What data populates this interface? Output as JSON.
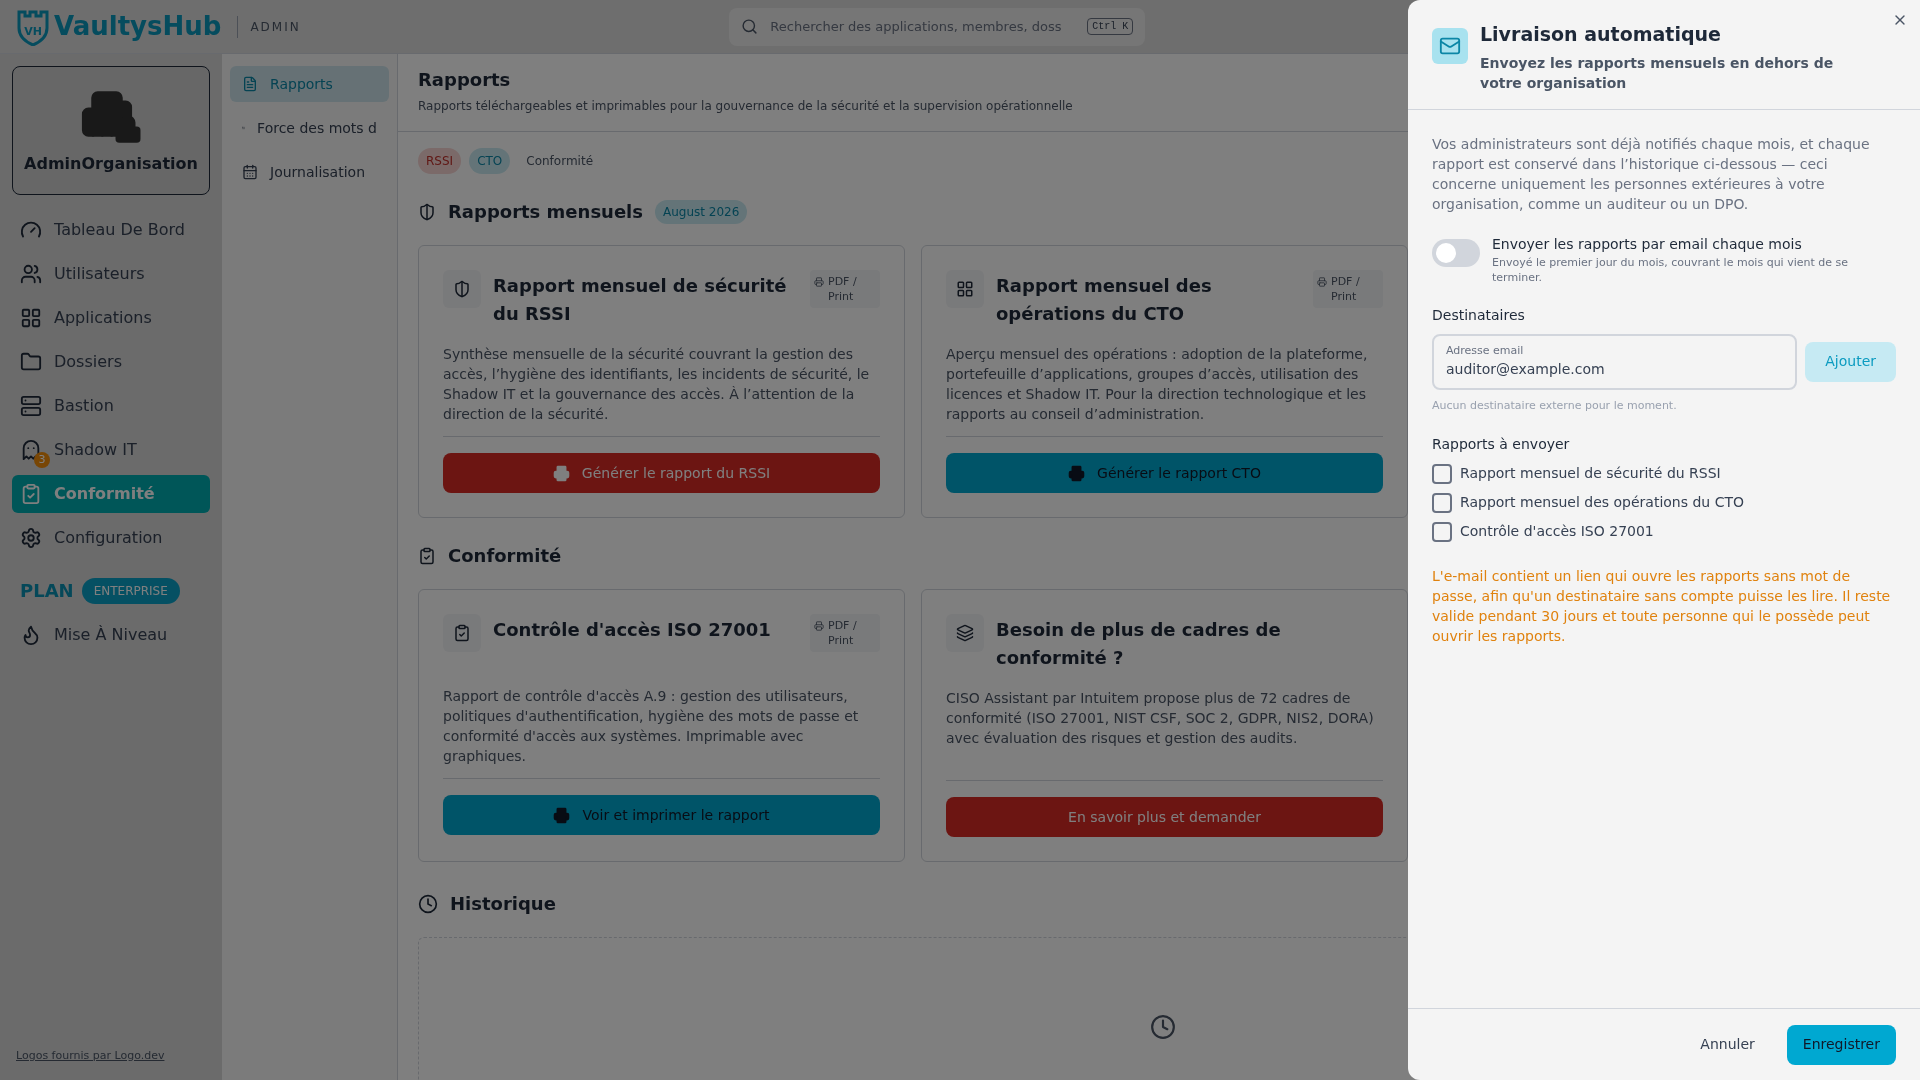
{
  "header": {
    "logo_mark": "VH",
    "brand": "VaultysHub",
    "section": "ADMIN",
    "search": {
      "placeholder": "Rechercher des applications, membres, doss",
      "shortcut": "Ctrl K"
    }
  },
  "organization": {
    "name": "AdminOrganisation"
  },
  "sidebar": {
    "items": [
      {
        "label": "Tableau De Bord",
        "selected": false
      },
      {
        "label": "Utilisateurs",
        "selected": false
      },
      {
        "label": "Applications",
        "selected": false
      },
      {
        "label": "Dossiers",
        "selected": false
      },
      {
        "label": "Bastion",
        "selected": false
      },
      {
        "label": "Shadow IT",
        "selected": false,
        "badge": "3"
      },
      {
        "label": "Conformité",
        "selected": true
      },
      {
        "label": "Configuration",
        "selected": false
      }
    ],
    "plan": {
      "label": "PLAN",
      "tier": "ENTERPRISE"
    },
    "upgrade": {
      "label": "Mise À Niveau"
    },
    "footer_link": "Logos fournis par Logo.dev"
  },
  "subnav": {
    "items": [
      {
        "label": "Rapports",
        "selected": true
      },
      {
        "label": "Force des mots d",
        "selected": false
      },
      {
        "label": "Journalisation",
        "selected": false
      }
    ]
  },
  "page": {
    "title": "Rapports",
    "subtitle": "Rapports téléchargeables et imprimables pour la gouvernance de la sécurité et la supervision opérationnelle",
    "chips": [
      {
        "label": "RSSI",
        "kind": "danger"
      },
      {
        "label": "CTO",
        "kind": "info"
      },
      {
        "label": "Conformité",
        "kind": "plain"
      }
    ],
    "sections": [
      {
        "title": "Rapports mensuels",
        "badge": "August 2026",
        "cards": [
          {
            "title": "Rapport mensuel de sécurité du RSSI",
            "badge": "PDF / Print",
            "description": "Synthèse mensuelle de la sécurité couvrant la gestion des accès, l’hygiène des identifiants, les incidents de sécurité, le Shadow IT et la gouvernance des accès. À l’attention de la direction de la sécurité.",
            "button": {
              "label": "Générer le rapport du RSSI",
              "kind": "danger",
              "printer": true
            }
          },
          {
            "title": "Rapport mensuel des opérations du CTO",
            "badge": "PDF / Print",
            "description": "Aperçu mensuel des opérations : adoption de la plateforme, portefeuille d’applications, groupes d’accès, utilisation des licences et Shadow IT. Pour la direction technologique et les rapports au conseil d’administration.",
            "button": {
              "label": "Générer le rapport CTO",
              "kind": "primary",
              "printer": true
            }
          }
        ]
      },
      {
        "title": "Conformité",
        "cards": [
          {
            "title": "Contrôle d'accès ISO 27001",
            "badge": "PDF / Print",
            "description": "Rapport de contrôle d'accès A.9 : gestion des utilisateurs, politiques d'authentification, hygiène des mots de passe et conformité d'accès aux systèmes. Imprimable avec graphiques.",
            "button": {
              "label": "Voir et imprimer le rapport",
              "kind": "primary",
              "printer": true
            }
          },
          {
            "title": "Besoin de plus de cadres de conformité ?",
            "description": "CISO Assistant par Intuitem propose plus de 72 cadres de conformité (ISO 27001, NIST CSF, SOC 2, GDPR, NIS2, DORA) avec évaluation des risques et gestion des audits.",
            "button": {
              "label": "En savoir plus et demander",
              "kind": "danger",
              "printer": false
            }
          }
        ]
      }
    ],
    "history": {
      "title": "Historique"
    }
  },
  "drawer": {
    "title": "Livraison automatique",
    "subtitle": "Envoyez les rapports mensuels en dehors de votre organisation",
    "intro": "Vos administrateurs sont déjà notifiés chaque mois, et chaque rapport est conservé dans l’historique ci-dessous — ceci concerne uniquement les personnes extérieures à votre organisation, comme un auditeur ou un DPO.",
    "toggle": {
      "label": "Envoyer les rapports par email chaque mois",
      "hint": "Envoyé le premier jour du mois, couvrant le mois qui vient de se terminer.",
      "on": false
    },
    "recipients": {
      "title": "Destinataires",
      "field_label": "Adresse email",
      "placeholder": "auditor@example.com",
      "add_button": "Ajouter",
      "empty_note": "Aucun destinataire externe pour le moment."
    },
    "reports": {
      "title": "Rapports à envoyer",
      "items": [
        {
          "label": "Rapport mensuel de sécurité du RSSI",
          "checked": false
        },
        {
          "label": "Rapport mensuel des opérations du CTO",
          "checked": false
        },
        {
          "label": "Contrôle d'accès ISO 27001",
          "checked": false
        }
      ]
    },
    "warning": "L'e-mail contient un lien qui ouvre les rapports sans mot de passe, afin qu'un destinataire sans compte puisse les lire. Il reste valide pendant 30 jours et toute personne qui le possède peut ouvrir les rapports.",
    "buttons": {
      "cancel": "Annuler",
      "save": "Enregistrer"
    }
  }
}
